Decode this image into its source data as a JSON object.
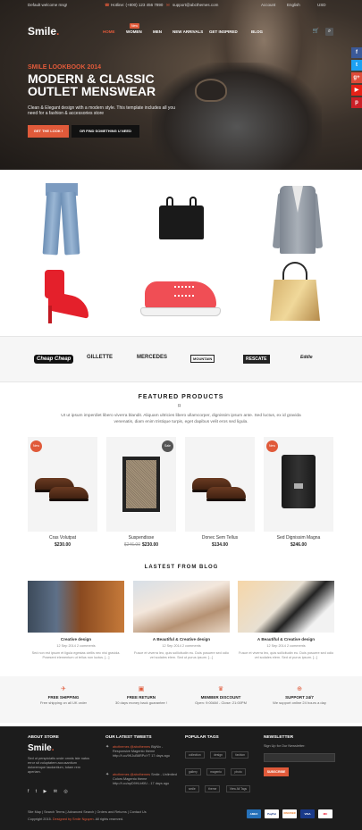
{
  "topbar": {
    "welcome": "Default welcome msg!",
    "phone": "Hotline: (+800) 123 456 7890",
    "email": "support@abcthemes.com",
    "account": "Account",
    "language": "English",
    "currency": "USD"
  },
  "header": {
    "logo": "Smile",
    "logo_dot": ".",
    "nav": [
      "HOME",
      "WOMEN",
      "MEN",
      "NEW ARRIVALS",
      "GET INSPIRED",
      "BLOG"
    ],
    "new_badge": "New"
  },
  "hero": {
    "subtitle": "SMILE LOOKBOOK 2014",
    "title": "MODERN & CLASSIC OUTLET MENSWEAR",
    "desc": "Clean & Elegant design with a modern style. This template includes all you need for a fashion & accessories store",
    "btn_primary": "GET THE LOOK !",
    "btn_secondary": "OR FIND SOMETHING U NEED"
  },
  "social": {
    "colors": [
      "#3b5998",
      "#1da1f2",
      "#dd4b39",
      "#e62117",
      "#cb2027"
    ],
    "icons": [
      "f",
      "t",
      "g+",
      "▶",
      "p"
    ]
  },
  "brands": [
    "Cheap Cheap",
    "GILLETTE",
    "MERCEDES",
    "MOUNTAIN",
    "RESCATE",
    "Eddie"
  ],
  "featured": {
    "title": "FEATURED PRODUCTS",
    "desc": "Ut ut ipsum imperdiet libero viverra blandit. Aliquam ultricies libero ullamcorper, dignissim ipsum ante. Sed luctus, ex id gravida venenatis, diam enim tristique turpis, eget dapibus velit eros sed ligula.",
    "products": [
      {
        "badge": "New",
        "badge_color": "#e05a3a",
        "name": "Cras Volutpat",
        "price": "$230.00",
        "old_price": ""
      },
      {
        "badge": "Sale",
        "badge_color": "#555555",
        "name": "Suspendisse",
        "price": "$230.00",
        "old_price": "$246.00"
      },
      {
        "badge": "",
        "badge_color": "",
        "name": "Donec Sem Tellus",
        "price": "$134.00",
        "old_price": ""
      },
      {
        "badge": "New",
        "badge_color": "#e05a3a",
        "name": "Sed Dignissim Magna",
        "price": "$246.00",
        "old_price": ""
      }
    ]
  },
  "blog": {
    "title": "LASTEST FROM BLOG",
    "posts": [
      {
        "title": "Creative design",
        "meta": "12 Sep 2014   2 comments",
        "text": "Sed non est ipsum et ligula egestas ciellis nec nisi gravida. Praesent elementum ut tellus non luctus. [...]"
      },
      {
        "title": "A Beautiful & Creative design",
        "meta": "12 Sep 2014   2 comments",
        "text": "Fusce et viverra leo, quis sollicitudin eu. Duis posuere sed odio vel sodales elem. Sed ut purus ipsum. [...]"
      },
      {
        "title": "A Beautiful & Creative design",
        "meta": "12 Sep 2014   2 comments",
        "text": "Fusce et viverra leo, quis sollicitudin eu. Duis posuere sed odio vel sodales elem. Sed ut purus ipsum. [...]"
      }
    ]
  },
  "services": [
    {
      "icon": "✈",
      "title": "FREE SHIPPING",
      "desc": "Free shipping on all UK order"
    },
    {
      "icon": "▣",
      "title": "FREE RETURN",
      "desc": "30 days money back guarantee !"
    },
    {
      "icon": "♛",
      "title": "MEMBER DISCOUNT",
      "desc": "Open: 9:00AM - Close: 21:00PM"
    },
    {
      "icon": "⊕",
      "title": "SUPPORT 24/7",
      "desc": "We support online 24 hours a day"
    }
  ],
  "footer": {
    "about_title": "ABOUT STORE",
    "logo": "Smile",
    "logo_dot": ".",
    "about_text": "Sed ut perspiciatis unde omnis iste natus error sit voluptatem accusantium doloremque laudantium, totam rem aperiam.",
    "social_icons": "f  t  ▶  ✉  ◎",
    "tweets_title": "OUR LATEST TWEETS",
    "tweets": [
      {
        "user": "abcthemes @abcthemes",
        "text": "BlyNix - Responsive Magento theme http://t.co/9KJuB6RPoYT 17 days ago"
      },
      {
        "user": "abcthemes @abcthemes",
        "text": "Smile - Unlimited Colors Magento theme http://t.co/apD9HLbKfU - 17 days ago"
      }
    ],
    "tags_title": "POPULAR TAGS",
    "tags": [
      "collection",
      "design",
      "fashion",
      "gallery",
      "magento",
      "photo",
      "smile",
      "theme",
      "View All Tags"
    ],
    "newsletter_title": "NEWSLETTER",
    "newsletter_text": "Sign Up for Our Newsletter:",
    "subscribe": "SUBSCRIBE",
    "links": "Site Map | Search Terms | Advanced Search | Orders and Returns | Contact Us",
    "copyright": "Copyright 2015. ",
    "designer": "Designed by Smile Nguyen",
    "rights": ". All rights reserved.",
    "payments": [
      "AMEX",
      "PayPal",
      "DISCOVER",
      "VISA",
      "MC"
    ]
  }
}
